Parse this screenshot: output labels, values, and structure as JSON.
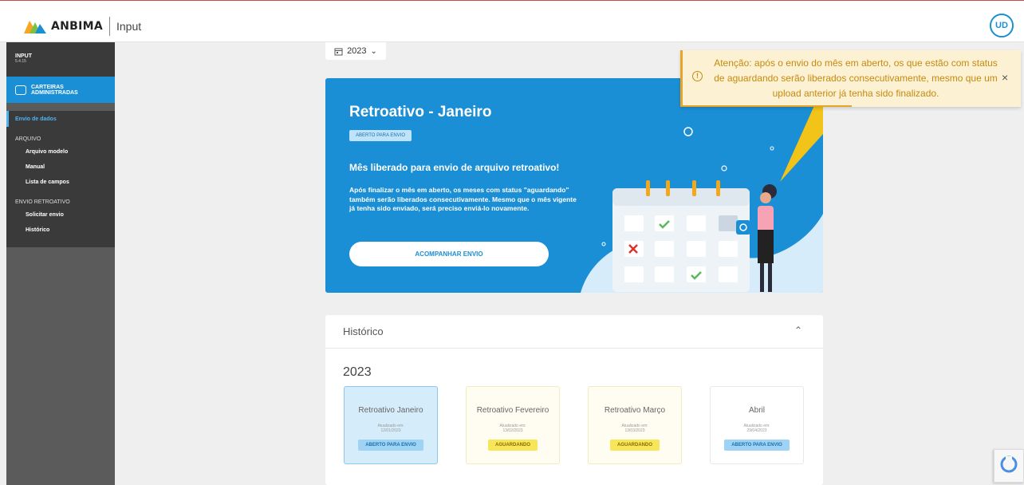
{
  "header": {
    "brand": "ANBIMA",
    "app_name": "Input",
    "avatar": "UD",
    "accent_color": "#1b8fd6"
  },
  "sidebar": {
    "title": "INPUT",
    "version": "5.4.15",
    "module_line1": "CARTEIRAS",
    "module_line2": "ADMINISTRADAS",
    "selected": "Envio de dados",
    "section_arquivo": "ARQUIVO",
    "arquivo_items": [
      {
        "label": "Arquivo modelo"
      },
      {
        "label": "Manual"
      },
      {
        "label": "Lista de campos"
      }
    ],
    "section_retro": "ENVIO RETROATIVO",
    "retro_items": [
      {
        "label": "Solicitar envio"
      },
      {
        "label": "Histórico"
      }
    ]
  },
  "year_selector": {
    "icon": "calendar-icon",
    "value": "2023"
  },
  "hero": {
    "title": "Retroativo - Janeiro",
    "badge": "ABERTO PARA ENVIO",
    "subtitle": "Mês liberado para envio de arquivo retroativo!",
    "description": "Após finalizar o mês em aberto, os meses com status \"aguardando\" também serão liberados consecutivamente. Mesmo que o mês vigente já tenha sido enviado, será preciso enviá-lo novamente.",
    "button": "ACOMPANHAR ENVIO"
  },
  "toast": {
    "icon": "alert-circle-icon",
    "message": "Atenção: após o envio do mês em aberto, os que estão com status de aguardando serão liberados consecutivamente, mesmo que um upload anterior já tenha sido finalizado.",
    "close": "×",
    "color": "#c58a0e"
  },
  "historico": {
    "title": "Histórico",
    "year": "2023",
    "months": [
      {
        "name": "Retroativo Janeiro",
        "updated_label": "Atualizado em:",
        "date": "12/01/2023",
        "status": "ABERTO PARA ENVIO"
      },
      {
        "name": "Retroativo Fevereiro",
        "updated_label": "Atualizado em:",
        "date": "13/02/2023",
        "status": "AGUARDANDO"
      },
      {
        "name": "Retroativo Março",
        "updated_label": "Atualizado em:",
        "date": "13/03/2023",
        "status": "AGUARDANDO"
      },
      {
        "name": "Abril",
        "updated_label": "Atualizado em:",
        "date": "29/04/2023",
        "status": "ABERTO PARA ENVIO"
      }
    ]
  }
}
